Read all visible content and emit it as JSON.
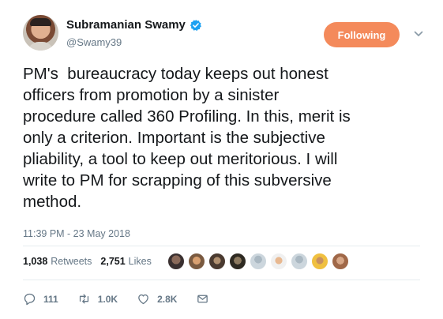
{
  "tweet": {
    "author_name": "Subramanian Swamy",
    "author_handle": "@Swamy39",
    "follow_label": "Following",
    "text": "PM's  bureaucracy today keeps out honest\nofficers from promotion by a sinister\nprocedure called 360 Profiling. In this, merit is\nonly a criterion. Important is the subjective\npliability, a tool to keep out meritorious. I will\nwrite to PM for scrapping of this subversive\nmethod.",
    "timestamp": "11:39 PM - 23 May 2018"
  },
  "stats": {
    "retweets_count": "1,038",
    "retweets_label": "Retweets",
    "likes_count": "2,751",
    "likes_label": "Likes"
  },
  "actions": {
    "replies": "111",
    "retweets": "1.0K",
    "likes": "2.8K"
  },
  "colors": {
    "follow_button": "#f48a5b",
    "verified": "#1da1f2",
    "muted_text": "#657786",
    "divider": "#e6ecf0"
  },
  "icons": [
    "verified-badge-icon",
    "chevron-down-icon",
    "reply-icon",
    "retweet-icon",
    "like-icon",
    "direct-message-icon"
  ]
}
